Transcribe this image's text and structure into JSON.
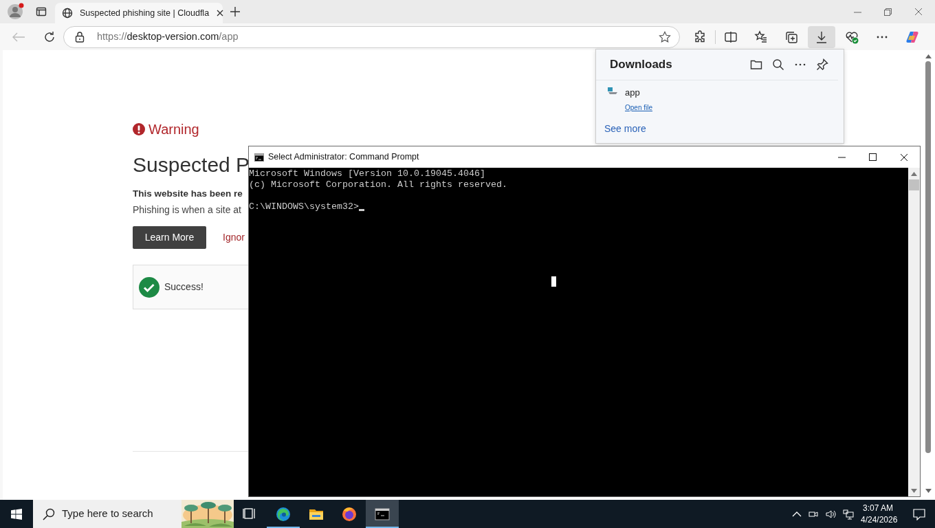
{
  "browser": {
    "tabs": [
      {
        "title": "Suspected phishing site | Cloudfla",
        "selected": true
      }
    ],
    "address": {
      "scheme": "https://",
      "host": "desktop-version.com",
      "path": "/app"
    },
    "downloads_button": {
      "selected": true
    }
  },
  "page": {
    "warning": "Warning",
    "heading": "Suspected P",
    "lead": "This website has been re",
    "text": "Phishing is when a site at",
    "learn_more": "Learn More",
    "ignore": "Ignor",
    "success": "Success!"
  },
  "downloads": {
    "title": "Downloads",
    "items": [
      {
        "name": "app",
        "action": "Open file"
      }
    ],
    "see_more": "See more"
  },
  "console": {
    "title": "Select Administrator: Command Prompt",
    "lines": [
      "Microsoft Windows [Version 10.0.19045.4046]",
      "(c) Microsoft Corporation. All rights reserved."
    ],
    "prompt": "C:\\WINDOWS\\system32>"
  },
  "taskbar": {
    "search_placeholder": "Type here to search",
    "apps": [
      {
        "kind": "task-view",
        "running": false,
        "selected": false
      },
      {
        "kind": "edge",
        "running": true,
        "selected": false
      },
      {
        "kind": "explorer",
        "running": false,
        "selected": false
      },
      {
        "kind": "firefox",
        "running": false,
        "selected": false
      },
      {
        "kind": "console",
        "running": true,
        "selected": true
      }
    ],
    "time": "3:07 AM",
    "date": "4/24/2026"
  }
}
